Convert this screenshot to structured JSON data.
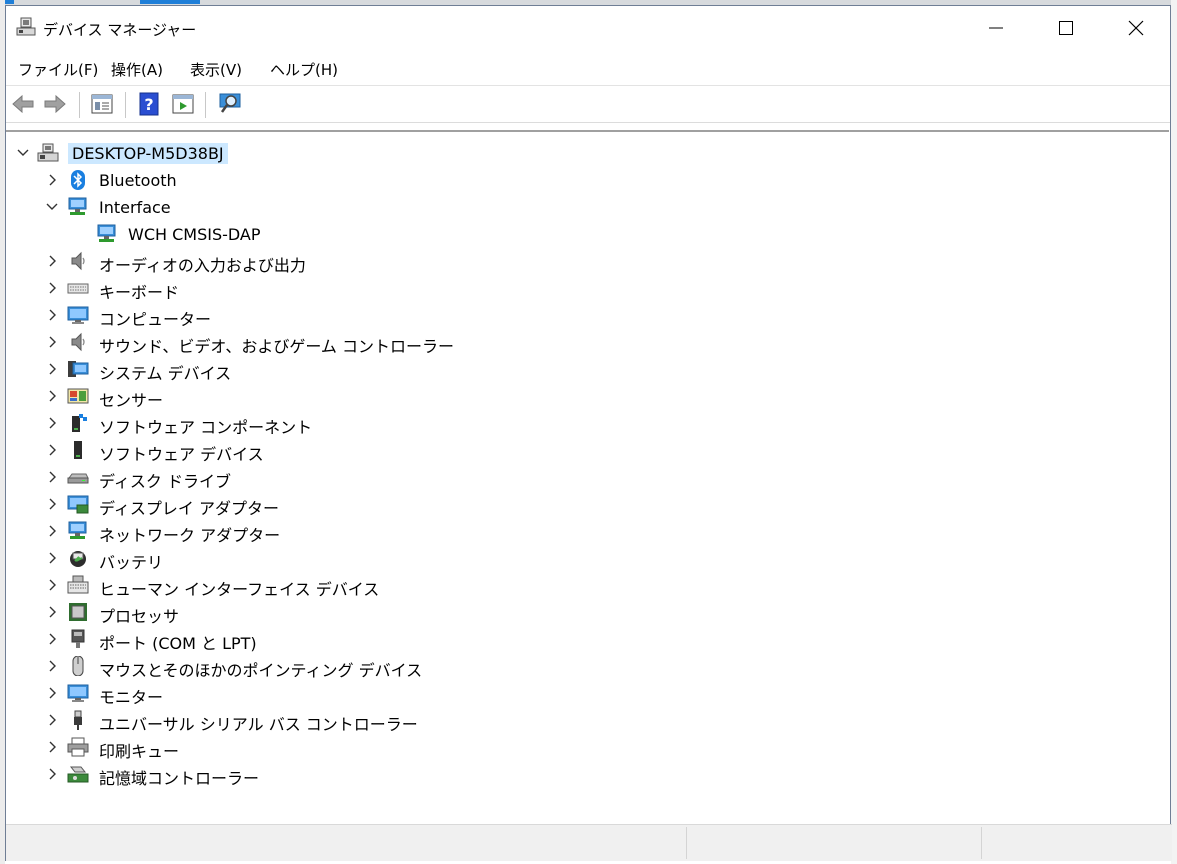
{
  "window": {
    "title": "デバイス マネージャー",
    "icon": "device-manager-icon"
  },
  "menubar": {
    "items": [
      "ファイル(F)",
      "操作(A)",
      "表示(V)",
      "ヘルプ(H)"
    ]
  },
  "toolbar": {
    "buttons": [
      "back-arrow-icon",
      "forward-arrow-icon",
      "properties-icon",
      "help-icon",
      "update-driver-icon",
      "scan-hardware-icon"
    ]
  },
  "tree": {
    "root": "DESKTOP-M5D38BJ",
    "items": [
      {
        "label": "Bluetooth",
        "icon": "bluetooth-icon",
        "expanded": false
      },
      {
        "label": "Interface",
        "icon": "network-icon",
        "expanded": true
      },
      {
        "label": "WCH CMSIS-DAP",
        "icon": "network-icon",
        "child": true
      },
      {
        "label": "オーディオの入力および出力",
        "icon": "speaker-icon",
        "expanded": false
      },
      {
        "label": "キーボード",
        "icon": "keyboard-icon",
        "expanded": false
      },
      {
        "label": "コンピューター",
        "icon": "monitor-icon",
        "expanded": false
      },
      {
        "label": "サウンド、ビデオ、およびゲーム コントローラー",
        "icon": "speaker-icon",
        "expanded": false
      },
      {
        "label": "システム デバイス",
        "icon": "system-device-icon",
        "expanded": false
      },
      {
        "label": "センサー",
        "icon": "sensor-icon",
        "expanded": false
      },
      {
        "label": "ソフトウェア コンポーネント",
        "icon": "software-component-icon",
        "expanded": false
      },
      {
        "label": "ソフトウェア デバイス",
        "icon": "software-device-icon",
        "expanded": false
      },
      {
        "label": "ディスク ドライブ",
        "icon": "disk-drive-icon",
        "expanded": false
      },
      {
        "label": "ディスプレイ アダプター",
        "icon": "display-adapter-icon",
        "expanded": false
      },
      {
        "label": "ネットワーク アダプター",
        "icon": "network-icon",
        "expanded": false
      },
      {
        "label": "バッテリ",
        "icon": "battery-icon",
        "expanded": false
      },
      {
        "label": "ヒューマン インターフェイス デバイス",
        "icon": "hid-icon",
        "expanded": false
      },
      {
        "label": "プロセッサ",
        "icon": "processor-icon",
        "expanded": false
      },
      {
        "label": "ポート (COM と LPT)",
        "icon": "port-icon",
        "expanded": false
      },
      {
        "label": "マウスとそのほかのポインティング デバイス",
        "icon": "mouse-icon",
        "expanded": false
      },
      {
        "label": "モニター",
        "icon": "monitor-icon",
        "expanded": false
      },
      {
        "label": "ユニバーサル シリアル バス コントローラー",
        "icon": "usb-icon",
        "expanded": false
      },
      {
        "label": "印刷キュー",
        "icon": "printer-icon",
        "expanded": false
      },
      {
        "label": "記憶域コントローラー",
        "icon": "storage-controller-icon",
        "expanded": false
      }
    ]
  },
  "colors": {
    "selection": "#cce8ff",
    "accent": "#1f7fd8"
  }
}
